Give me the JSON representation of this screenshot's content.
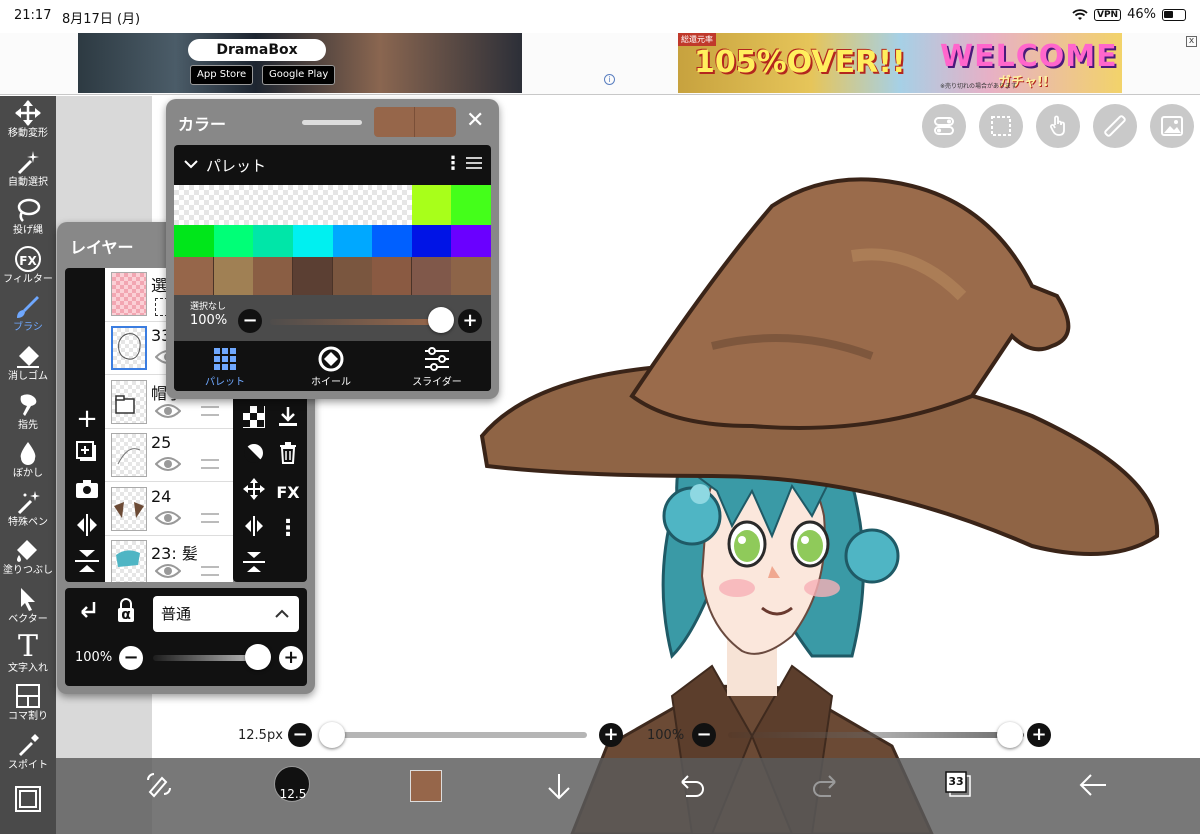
{
  "status": {
    "time": "21:17",
    "date": "8月17日 (月)",
    "vpn": "VPN",
    "battery": "46%"
  },
  "ads": {
    "ad1": {
      "brand": "DramaBox",
      "appstore": "App Store",
      "googleplay": "Google Play"
    },
    "ad2": {
      "corner": "総還元率",
      "big": "105%OVER!!",
      "welcome": "WELCOME",
      "gacha": "ガチャ!!",
      "note": "※売り切れの場合があります"
    },
    "close": "x",
    "info": "i"
  },
  "toolbar": {
    "items": [
      {
        "label": "移動変形",
        "icon": "move-icon"
      },
      {
        "label": "自動選択",
        "icon": "magic-wand-icon"
      },
      {
        "label": "投げ縄",
        "icon": "lasso-icon"
      },
      {
        "label": "フィルター",
        "icon": "fx-icon",
        "glyph": "FX"
      },
      {
        "label": "ブラシ",
        "icon": "brush-icon",
        "active": true
      },
      {
        "label": "消しゴム",
        "icon": "eraser-icon"
      },
      {
        "label": "指先",
        "icon": "smudge-icon"
      },
      {
        "label": "ぼかし",
        "icon": "blur-icon"
      },
      {
        "label": "特殊ペン",
        "icon": "special-pen-icon"
      },
      {
        "label": "塗りつぶし",
        "icon": "fill-bucket-icon"
      },
      {
        "label": "ベクター",
        "icon": "vector-icon"
      },
      {
        "label": "文字入れ",
        "icon": "text-icon",
        "glyph": "T"
      },
      {
        "label": "コマ割り",
        "icon": "panel-icon"
      },
      {
        "label": "スポイト",
        "icon": "eyedropper-icon"
      }
    ]
  },
  "brush_size": {
    "label": "12.5px",
    "value": 12.5,
    "min": 0,
    "max": 1000
  },
  "brush_opacity": {
    "label": "100%",
    "percent": 100
  },
  "bottombar": {
    "brush_size_badge": "12.5",
    "layer_count": "33",
    "color": "#96664a"
  },
  "layers": {
    "title": "レイヤー",
    "selection_label": "選択",
    "rows": [
      {
        "name": "33"
      },
      {
        "name": "帽子"
      },
      {
        "name": "25"
      },
      {
        "name": "24"
      },
      {
        "name": "23: 髪"
      }
    ],
    "blend_mode": "普通",
    "opacity_label": "100%",
    "opacity_percent": 100,
    "alpha_glyph": "α",
    "fx_glyph": "FX"
  },
  "color_panel": {
    "title": "カラー",
    "section": "パレット",
    "current_color": "#96664a",
    "palette": {
      "row1": [
        "",
        "",
        "",
        "",
        "",
        "",
        "#a8ff1a",
        "#44ff1a"
      ],
      "row2": [
        "#00e61a",
        "#00ff77",
        "#00e6a8",
        "#00f0f0",
        "#00a8ff",
        "#0060ff",
        "#0014e6",
        "#6a00ff"
      ],
      "row3": [
        "#96664a",
        "#a08054",
        "#8a5e44",
        "#5b3f33",
        "#7a563f",
        "#8a5a42",
        "#80584a",
        "#8d6448"
      ]
    },
    "selection_none": "選択なし",
    "opacity_label": "100%",
    "opacity_percent": 100,
    "tabs": [
      {
        "label": "パレット",
        "active": true
      },
      {
        "label": "ホイール",
        "active": false
      },
      {
        "label": "スライダー",
        "active": false
      }
    ]
  }
}
